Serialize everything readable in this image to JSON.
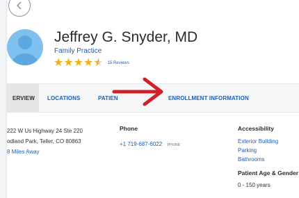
{
  "profile": {
    "name": "Jeffrey G. Snyder, MD",
    "specialty": "Family Practice",
    "rating": 4.5,
    "rating_max": 5,
    "reviews": "15 Reviews"
  },
  "tabs": [
    {
      "label": "ERVIEW",
      "active": true
    },
    {
      "label": "LOCATIONS",
      "active": false
    },
    {
      "label": "PATIEN",
      "active": false
    },
    {
      "label": "ENROLLMENT INFORMATION",
      "active": false
    }
  ],
  "address": {
    "line1": "222 W Us Highway 24 Ste 220",
    "line2": "odland Park, Teller, CO 80863",
    "distance": "8 Miles Away"
  },
  "phone": {
    "heading": "Phone",
    "number": "+1 719-687-6022",
    "type": "PHONE"
  },
  "accessibility": {
    "heading": "Accessibility",
    "items": [
      "Exterior Building",
      "Parking",
      "Bathrooms"
    ]
  },
  "patient_age": {
    "heading": "Patient Age & Gender",
    "value": "0 - 150  years"
  },
  "icons": {
    "back": "chevron-left-icon",
    "avatar": "person-icon",
    "arrow": "red-arrow-annotation"
  },
  "colors": {
    "link": "#1f5fb6",
    "star": "#f0b21a",
    "avatar": "#7ec1ee",
    "arrow": "#d0202a"
  }
}
